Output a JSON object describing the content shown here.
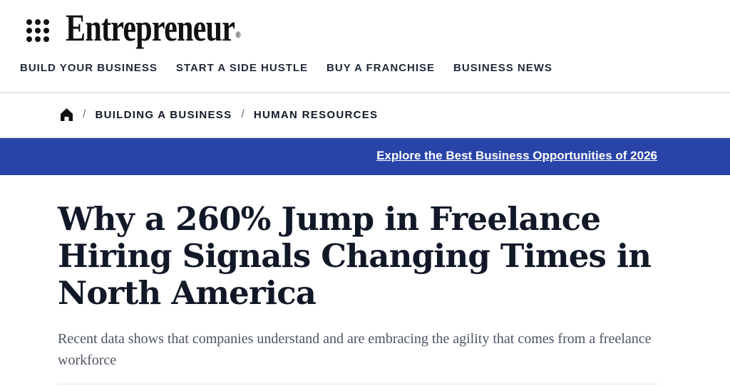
{
  "header": {
    "logo_text": "Entrepreneur",
    "logo_mark": "®",
    "nav": [
      {
        "label": "BUILD YOUR BUSINESS"
      },
      {
        "label": "START A SIDE HUSTLE"
      },
      {
        "label": "BUY A FRANCHISE"
      },
      {
        "label": "BUSINESS NEWS"
      }
    ]
  },
  "breadcrumb": {
    "separator": "/",
    "items": [
      {
        "label": "BUILDING A BUSINESS"
      },
      {
        "label": "HUMAN RESOURCES"
      }
    ]
  },
  "promo": {
    "link_text": "Explore the Best Business Opportunities of 2026",
    "background_color": "#2844a8"
  },
  "article": {
    "headline": "Why a 260% Jump in Freelance Hiring Signals Changing Times in North America",
    "dek": "Recent data shows that companies understand and are embracing the agility that comes from a freelance workforce"
  }
}
